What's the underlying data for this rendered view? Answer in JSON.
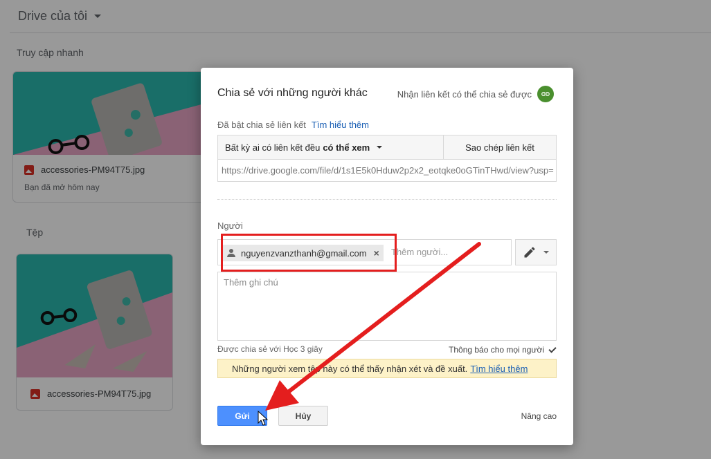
{
  "background": {
    "drive_title": "Drive của tôi",
    "quick_access_title": "Truy cập nhanh",
    "files_title": "Tệp",
    "quick_card": {
      "file_name": "accessories-PM94T75.jpg",
      "opened_text": "Bạn đã mở hôm nay"
    },
    "file_card": {
      "file_name": "accessories-PM94T75.jpg"
    },
    "icons": [
      "image-file-icon",
      "chevron-down-icon"
    ]
  },
  "dialog": {
    "title": "Chia sẻ với những người khác",
    "get_link_label": "Nhận liên kết có thể chia sẻ được",
    "link_sharing_on": "Đã bật chia sẻ liên kết",
    "learn_more": "Tìm hiểu thêm",
    "access_prefix": "Bất kỳ ai có liên kết đều",
    "access_level": "có thể xem",
    "copy_link": "Sao chép liên kết",
    "link_url": "https://drive.google.com/file/d/1s1E5k0Hduw2p2x2_eotqke0oGTinTHwd/view?usp=",
    "people_label": "Người",
    "chip_email": "nguyenzvanzthanh@gmail.com",
    "chip_remove": "×",
    "add_people_placeholder": "Thêm người...",
    "note_placeholder": "Thêm ghi chú",
    "shared_with": "Được chia sẻ với Học 3 giây",
    "notify_label": "Thông báo cho mọi người",
    "notify_checked": true,
    "warning_text": "Những người xem tệp này có thể thấy nhận xét và đề xuất.",
    "warning_learn_more": "Tìm hiểu thêm",
    "send": "Gửi",
    "cancel": "Hủy",
    "advanced": "Nâng cao",
    "colors": {
      "send_button": "#4d90fe",
      "link_icon": "#4a8f2e",
      "highlight": "#e41e1e",
      "warning_bg": "#fdf2c8"
    }
  }
}
